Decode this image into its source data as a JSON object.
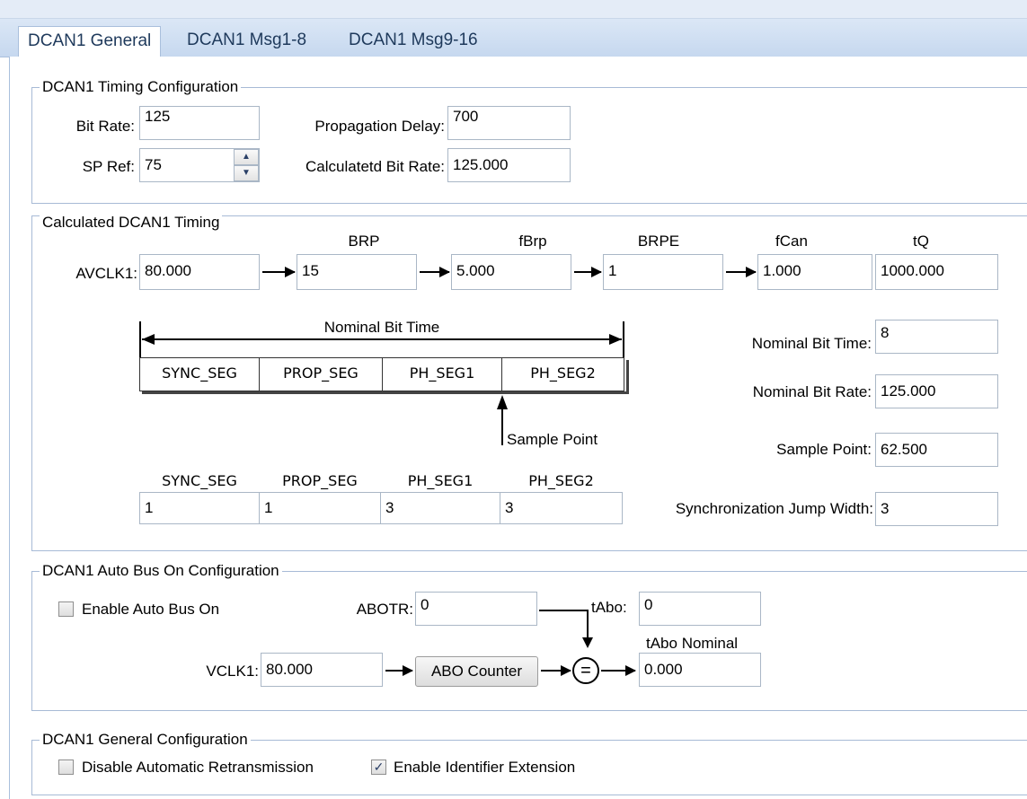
{
  "tabs": [
    "DCAN1 General",
    "DCAN1 Msg1-8",
    "DCAN1 Msg9-16"
  ],
  "timing_config": {
    "title": "DCAN1 Timing Configuration",
    "bit_rate_label": "Bit Rate:",
    "bit_rate": "125",
    "sp_ref_label": "SP Ref:",
    "sp_ref": "75",
    "prop_delay_label": "Propagation Delay:",
    "prop_delay": "700",
    "calc_bit_rate_label": "Calculatetd Bit Rate:",
    "calc_bit_rate": "125.000"
  },
  "calc_timing": {
    "title": "Calculated DCAN1 Timing",
    "avclk_label": "AVCLK1:",
    "avclk": "80.000",
    "brp_label": "BRP",
    "brp": "15",
    "fbrp_label": "fBrp",
    "fbrp": "5.000",
    "brpe_label": "BRPE",
    "brpe": "1",
    "fcan_label": "fCan",
    "fcan": "1.000",
    "tq_label": "tQ",
    "tq": "1000.000",
    "diagram_title": "Nominal Bit Time",
    "segments": [
      "SYNC_SEG",
      "PROP_SEG",
      "PH_SEG1",
      "PH_SEG2"
    ],
    "sample_point_caption": "Sample Point",
    "segment_values": [
      "1",
      "1",
      "3",
      "3"
    ],
    "nominal_bit_time_label": "Nominal Bit Time:",
    "nominal_bit_time": "8",
    "nominal_bit_rate_label": "Nominal Bit Rate:",
    "nominal_bit_rate": "125.000",
    "sample_point_label": "Sample Point:",
    "sample_point": "62.500",
    "sjw_label": "Synchronization Jump Width:",
    "sjw": "3"
  },
  "auto_bus": {
    "title": "DCAN1 Auto Bus On Configuration",
    "enable_label": "Enable Auto Bus On",
    "enable_checked": false,
    "abotr_label": "ABOTR:",
    "abotr": "0",
    "tabo_label": "tAbo:",
    "tabo": "0",
    "tabo_nominal_label": "tAbo Nominal",
    "tabo_nominal": "0.000",
    "vclk_label": "VCLK1:",
    "vclk": "80.000",
    "abo_button": "ABO Counter",
    "equals_symbol": "="
  },
  "general_config": {
    "title": "DCAN1 General Configuration",
    "disable_retx_label": "Disable Automatic Retransmission",
    "disable_retx_checked": false,
    "enable_ide_label": "Enable Identifier Extension",
    "enable_ide_checked": true
  },
  "check_mark": "✓",
  "spin_up": "▲",
  "spin_down": "▼"
}
